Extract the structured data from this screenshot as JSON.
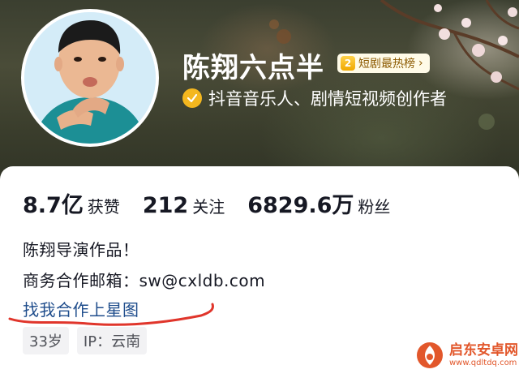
{
  "profile": {
    "name": "陈翔六点半",
    "rank_badge": {
      "number": "2",
      "label": "短剧最热榜",
      "arrow": "›"
    },
    "verification": "抖音音乐人、剧情短视频创作者"
  },
  "stats": [
    {
      "value": "8.7亿",
      "label": "获赞"
    },
    {
      "value": "212",
      "label": "关注"
    },
    {
      "value": "6829.6万",
      "label": "粉丝"
    }
  ],
  "bio": {
    "line1": "陈翔导演作品！",
    "line2": "商务合作邮箱：sw@cxldb.com",
    "link": "找我合作上星图"
  },
  "tags": [
    "33岁",
    "IP：云南"
  ],
  "watermark": {
    "title": "启东安卓网",
    "url": "www.qdltdq.com"
  },
  "colors": {
    "badge_gold": "#f4b71f",
    "link_blue": "#1f4d8c",
    "annotation_red": "#e0352b",
    "watermark_orange": "#e2572b"
  }
}
